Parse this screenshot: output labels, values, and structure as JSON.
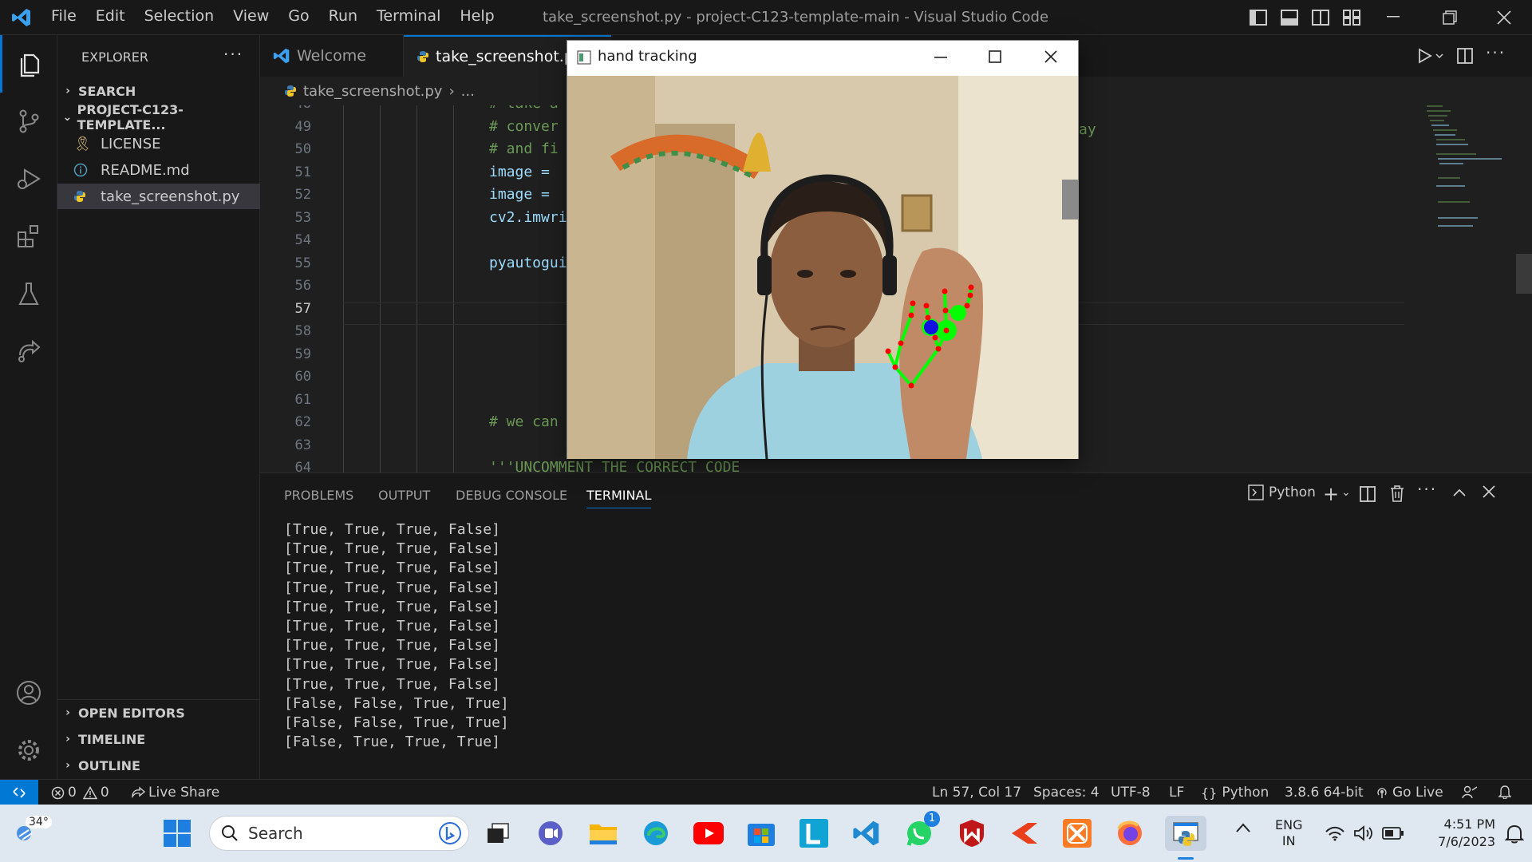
{
  "window": {
    "title": "take_screenshot.py - project-C123-template-main - Visual Studio Code",
    "menu": [
      "File",
      "Edit",
      "Selection",
      "View",
      "Go",
      "Run",
      "Terminal",
      "Help"
    ]
  },
  "sidebar": {
    "title": "EXPLORER",
    "search_label": "SEARCH",
    "project_label": "PROJECT-C123-TEMPLATE...",
    "files": [
      "LICENSE",
      "README.md",
      "take_screenshot.py"
    ],
    "open_editors": "OPEN EDITORS",
    "timeline": "TIMELINE",
    "outline": "OUTLINE"
  },
  "tabs": [
    {
      "label": "Welcome",
      "icon": "vscode-icon"
    },
    {
      "label": "take_screenshot.py",
      "icon": "python-icon"
    }
  ],
  "breadcrumb": {
    "file": "take_screenshot.py",
    "rest": "..."
  },
  "editor": {
    "active_line": 57,
    "lines": [
      {
        "n": 48,
        "text": "# take a",
        "kind": "comment"
      },
      {
        "n": 49,
        "text": "# conver",
        "kind": "comment"
      },
      {
        "n": 50,
        "text": "# and fi",
        "kind": "comment"
      },
      {
        "n": 51,
        "text": "image = ",
        "kind": "code"
      },
      {
        "n": 52,
        "text": "image = ",
        "kind": "code"
      },
      {
        "n": 53,
        "text": "cv2.imwri",
        "kind": "code"
      },
      {
        "n": 54,
        "text": "",
        "kind": "code"
      },
      {
        "n": 55,
        "text": "pyautogui",
        "kind": "code"
      },
      {
        "n": 56,
        "text": "",
        "kind": "code"
      },
      {
        "n": 57,
        "text": "",
        "kind": "code"
      },
      {
        "n": 58,
        "text": "",
        "kind": "code"
      },
      {
        "n": 59,
        "text": "",
        "kind": "code"
      },
      {
        "n": 60,
        "text": "",
        "kind": "code"
      },
      {
        "n": 61,
        "text": "",
        "kind": "code"
      },
      {
        "n": 62,
        "text": "# we can",
        "kind": "comment"
      },
      {
        "n": 63,
        "text": "",
        "kind": "code"
      },
      {
        "n": 64,
        "text": "'''UNCOMMENT THE CORRECT CODE",
        "kind": "comment"
      }
    ],
    "overflow_text": "ay"
  },
  "panel": {
    "tabs": [
      "PROBLEMS",
      "OUTPUT",
      "DEBUG CONSOLE",
      "TERMINAL"
    ],
    "active_tab": "TERMINAL",
    "shell": "Python",
    "terminal_lines": [
      "[True, True, True, False]",
      "[True, True, True, False]",
      "[True, True, True, False]",
      "[True, True, True, False]",
      "[True, True, True, False]",
      "[True, True, True, False]",
      "[True, True, True, False]",
      "[True, True, True, False]",
      "[True, True, True, False]",
      "[False, False, True, True]",
      "[False, False, True, True]",
      "[False, True, True, True]"
    ]
  },
  "statusbar": {
    "errors": "0",
    "warnings": "0",
    "live_share": "Live Share",
    "position": "Ln 57, Col 17",
    "spaces": "Spaces: 4",
    "encoding": "UTF-8",
    "eol": "LF",
    "language": "Python",
    "interpreter": "3.8.6 64-bit",
    "go_live": "Go Live"
  },
  "floating_window": {
    "title": "hand tracking"
  },
  "taskbar": {
    "weather": "34°",
    "search_placeholder": "Search",
    "whatsapp_badge": "1",
    "lang_line1": "ENG",
    "lang_line2": "IN",
    "time": "4:51 PM",
    "date": "7/6/2023"
  },
  "colors": {
    "accent": "#0078d4",
    "landmark_green": "#00ff00",
    "landmark_red": "#ff0000"
  }
}
